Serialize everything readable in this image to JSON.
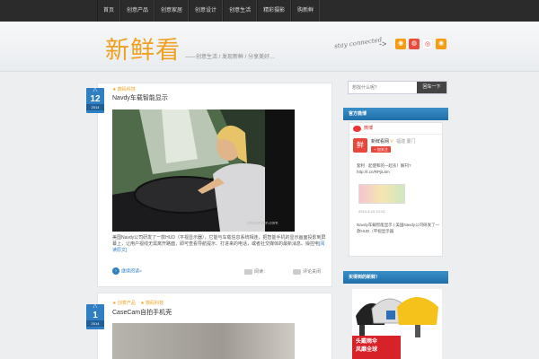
{
  "nav": {
    "items": [
      "首页",
      "创意产品",
      "创意家居",
      "创意设计",
      "创意生活",
      "精彩摄影",
      "购新鲜"
    ]
  },
  "header": {
    "logo": "新鲜看",
    "slogan": "——创意生活 / 发现新鲜 / 分享美好…",
    "stay_connected": "stay connected",
    "arrow": "->",
    "social_icons": [
      "rss-icon",
      "tencent-weibo-icon",
      "sina-weibo-icon",
      "rss-feed-icon"
    ]
  },
  "posts": [
    {
      "date": {
        "month": "八",
        "day": "12",
        "year": "2014"
      },
      "category": "数码科技",
      "title": "Navdy车载智能显示",
      "excerpt": "美国Navdy公司研发了一款HUD（平视显示器），它能与车载信息系统相连，把智能手机的显示画面投影到屏幕上，让用户视线无需离开路面，即可查看导航提示、打进来的电话，或者社交媒体的最新消息。操控电",
      "excerpt_more": "[阅读原文]",
      "read_more": "继续阅读»",
      "read_label": "阅读：",
      "comment_label": "评论关闭"
    },
    {
      "date": {
        "month": "八",
        "day": "1",
        "year": "2014"
      },
      "categories": [
        "创意产品",
        "数码科技"
      ],
      "title": "CaseCam自拍手机壳"
    }
  ],
  "sidebar": {
    "search": {
      "placeholder": "想找什么呢？",
      "button": "回车一下"
    },
    "weibo_widget": {
      "title": "官方微博",
      "brand": "微博",
      "avatar": "鲜",
      "name": "新鲜看网",
      "location": "福建 厦门",
      "follow": "+ 加关注",
      "text1": "套利 · 起使和的一起农！解刊? http://t.cn/RPjiL6m",
      "time": "2014-8-15 10:14",
      "text2": "Navdy车载智能显示 | 美国Navdy公司研发了一款HUD（平视显示器"
    },
    "shop_widget": {
      "title": "买得到的新鲜！",
      "ad_text": [
        "头戴雨伞",
        "风靡全球"
      ]
    }
  },
  "colors": {
    "accent": "#f0a020",
    "blue": "#2f7fc2",
    "nav_bg": "#2b2b2b"
  }
}
